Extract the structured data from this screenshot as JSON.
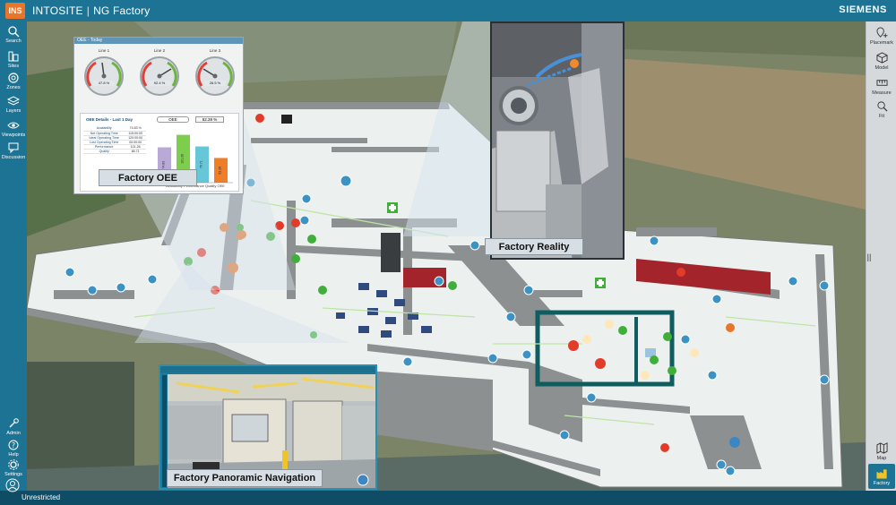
{
  "app": {
    "logo": "INS",
    "name": "INTOSITE",
    "project": "NG Factory",
    "brand": "SIEMENS",
    "status": "Unrestricted"
  },
  "left_nav": [
    {
      "label": "Search",
      "icon": "search-icon"
    },
    {
      "label": "Sites",
      "icon": "sites-icon"
    },
    {
      "label": "Zones",
      "icon": "zones-icon"
    },
    {
      "label": "Layers",
      "icon": "layers-icon"
    },
    {
      "label": "Viewpoints",
      "icon": "eye-icon"
    },
    {
      "label": "Discussion",
      "icon": "chat-icon"
    },
    {
      "label": "Admin",
      "icon": "admin-icon"
    },
    {
      "label": "Help",
      "icon": "help-icon"
    },
    {
      "label": "Settings",
      "icon": "gear-icon"
    }
  ],
  "right_nav": [
    {
      "label": "Placemark",
      "icon": "placemark-icon"
    },
    {
      "label": "Model",
      "icon": "cube-icon"
    },
    {
      "label": "Measure",
      "icon": "ruler-icon"
    },
    {
      "label": "Fit",
      "icon": "fit-icon"
    },
    {
      "label": "Map",
      "icon": "map-icon"
    },
    {
      "label": "Factory",
      "icon": "factory-icon"
    }
  ],
  "oee_panel": {
    "header": "OEE - Today",
    "gauges": [
      {
        "title": "Line 1",
        "value": "47.8 %"
      },
      {
        "title": "Line 2",
        "value": "92.4 %"
      },
      {
        "title": "Line 3",
        "value": "26.5 %"
      }
    ],
    "details_title": "OEE Details - Last 1 Day",
    "oee_label": "OEE",
    "oee_value": "52.28 %",
    "metrics": [
      {
        "name": "Availability",
        "value": "74.83 %"
      },
      {
        "name": "Net Operating Time",
        "value": "115:00:00"
      },
      {
        "name": "Ideal Operating Time",
        "value": "120:00:00"
      },
      {
        "name": "Lost Operating Time",
        "value": "00:00:00"
      },
      {
        "name": "Performance",
        "value": "101.26"
      },
      {
        "name": "Quality",
        "value": "66.71"
      }
    ],
    "legend": "Availability   Performance   Quality   OEE"
  },
  "chart_data": {
    "type": "bar",
    "categories": [
      "Availability",
      "Performance",
      "Quality",
      "OEE"
    ],
    "values": [
      74.83,
      101.26,
      76.71,
      52.28
    ],
    "colors": [
      "#b9a9d6",
      "#7dce4c",
      "#67c7d8",
      "#ef7e29"
    ],
    "ylim": [
      0,
      110
    ]
  },
  "callouts": {
    "oee": "Factory OEE",
    "reality": "Factory Reality",
    "pano": "Factory Panoramic Navigation"
  },
  "colors": {
    "nav": "#1d7394",
    "accent": "#e8752a",
    "factory_active": "#1d7394"
  }
}
